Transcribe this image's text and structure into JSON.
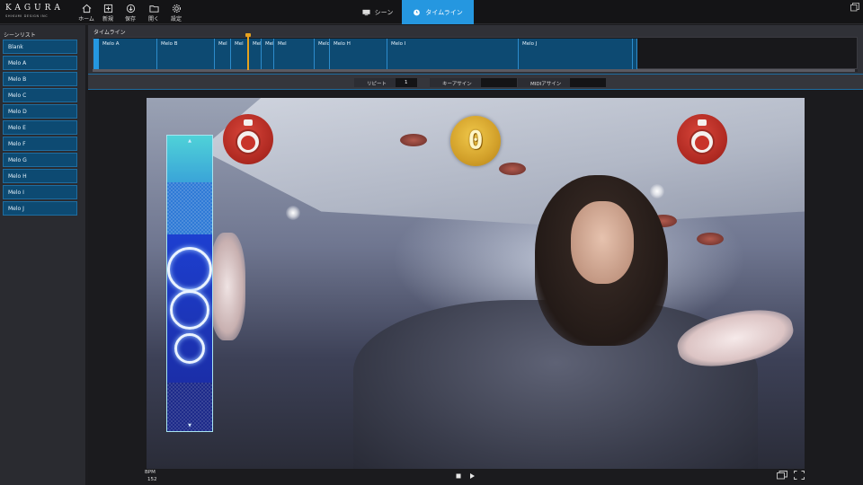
{
  "app": {
    "logo_text": "KAGURA",
    "logo_sub": "SHIKUMI DESIGN INC"
  },
  "toolbar": {
    "home_label": "ホーム",
    "new_label": "新規",
    "save_label": "保存",
    "open_label": "開く",
    "settings_label": "設定"
  },
  "tabs": [
    {
      "label": "シーン",
      "active": false
    },
    {
      "label": "タイムライン",
      "active": true
    }
  ],
  "sidebar": {
    "title": "シーンリスト",
    "items": [
      "Blank",
      "Melo A",
      "Melo B",
      "Melo C",
      "Melo D",
      "Melo E",
      "Melo F",
      "Melo G",
      "Melo H",
      "Melo I",
      "Melo J"
    ]
  },
  "timeline": {
    "title": "タイムライン",
    "blocks": [
      "Melo A",
      "Melo B",
      "Mel",
      "Mel",
      "Mel",
      "Melo E",
      "Mel",
      "Melo G",
      "Melo H",
      "Melo I",
      "Melo J"
    ]
  },
  "infobar": {
    "repeat_label": "リピート",
    "repeat_value": "1",
    "key_sign_label": "キーアサイン",
    "key_sign_value": "",
    "midi_sign_label": "MIDIアサイン",
    "midi_sign_value": ""
  },
  "overlay": {
    "coin_value": "0"
  },
  "footer": {
    "bpm_label": "BPM",
    "bpm_value": "152"
  },
  "colors": {
    "accent": "#2597e0",
    "scene_block": "#0d4a72",
    "playhead": "#e6a21e",
    "drum_red": "#c8342a",
    "coin_gold": "#e0b030"
  }
}
